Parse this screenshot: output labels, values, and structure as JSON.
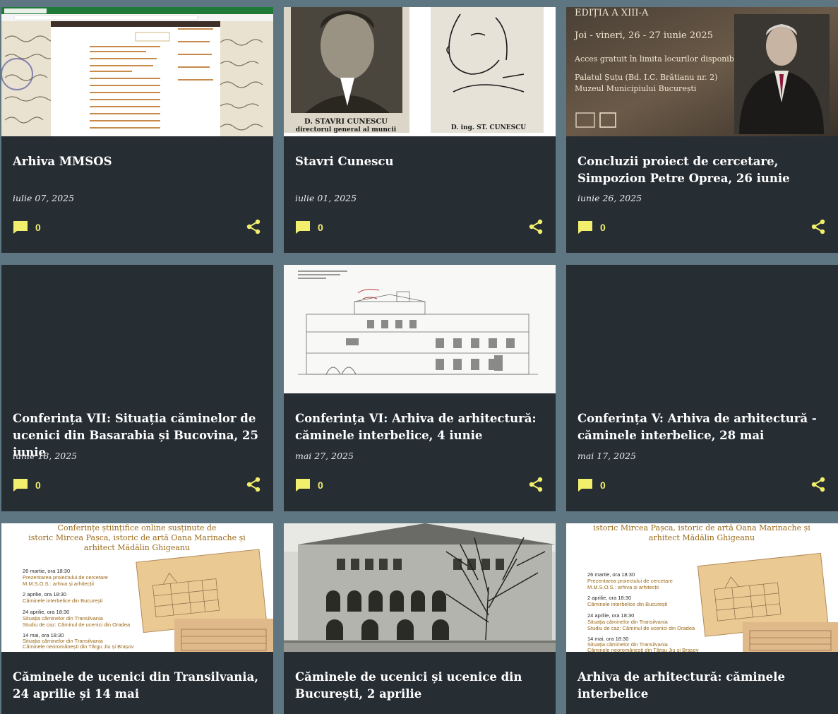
{
  "posts": [
    {
      "title": "Arhiva MMSOS",
      "date": "iulie 07, 2025",
      "comments": "0"
    },
    {
      "title": "Stavri Cunescu",
      "date": "iulie 01, 2025",
      "comments": "0"
    },
    {
      "title": "Concluzii proiect de cercetare, Simpozion Petre Oprea, 26 iunie",
      "date": "iunie 26, 2025",
      "comments": "0"
    },
    {
      "title": "Conferința VII: Situația căminelor de ucenici din Basarabia și Bucovina, 25 iunie",
      "date": "iunie 18, 2025",
      "comments": "0"
    },
    {
      "title": "Conferința VI: Arhiva de arhitectură: căminele interbelice, 4 iunie",
      "date": "mai 27, 2025",
      "comments": "0"
    },
    {
      "title": "Conferința V: Arhiva de arhitectură - căminele interbelice, 28 mai",
      "date": "mai 17, 2025",
      "comments": "0"
    },
    {
      "title": "Căminele de ucenici din Transilvania, 24 aprilie și 14 mai"
    },
    {
      "title": "Căminele de ucenici și ucenice din București, 2 aprilie"
    },
    {
      "title": "Arhiva de arhitectură: căminele interbelice"
    }
  ],
  "thumbs": {
    "stavri_caption_1": "D. STAVRI CUNESCU",
    "stavri_caption_2": "directorul general al muncii",
    "stavri_caption_3": "D. ing. ST. CUNESCU",
    "simpozion_line1": "EDIȚIA A XIII-A",
    "simpozion_line2": "Joi - vineri, 26 - 27 iunie 2025",
    "simpozion_line3": "Acces gratuit în limita locurilor disponibile.",
    "simpozion_line4": "Palatul Șuțu (Bd. I.C. Brătianu nr. 2)",
    "simpozion_line5": "Muzeul Municipiului București",
    "poster_a_head1": "Conferințe științifice online susținute de",
    "poster_a_head2": "istoric Mircea Pașca, istoric de artă Oana Marinache și",
    "poster_a_head3": "arhitect Mădălin Ghigeanu",
    "poster_b_head2": "istoric Mircea Pașca, istoric de artă Oana Marinache și",
    "poster_b_head3": "arhitect Mădălin Ghigeanu",
    "poster_items": [
      {
        "date": "26 martie, ora 18:30",
        "l1": "Prezentarea proiectului de cercetare",
        "l2": "M.M.S.O.S.: arhiva și arhitecții"
      },
      {
        "date": "2 aprilie, ora 18:30",
        "l1": "Căminele interbelice din București",
        "l2": ""
      },
      {
        "date": "24 aprilie, ora 18:30",
        "l1": "Situația căminelor din Transilvania",
        "l2": "Studiu de caz: Căminul de ucenici din Oradea"
      },
      {
        "date": "14 mai, ora 18:30",
        "l1": "Situația căminelor din Transilvania",
        "l2": "Căminele neoromânești din Târgu Jiu și Brașov"
      }
    ]
  },
  "colors": {
    "page_bg": "#5e7682",
    "card_bg": "#262d33",
    "accent": "#f2ef6c",
    "title": "#ffffff"
  },
  "icons": {
    "comment": "comment-bubble-icon",
    "share": "share-icon"
  }
}
